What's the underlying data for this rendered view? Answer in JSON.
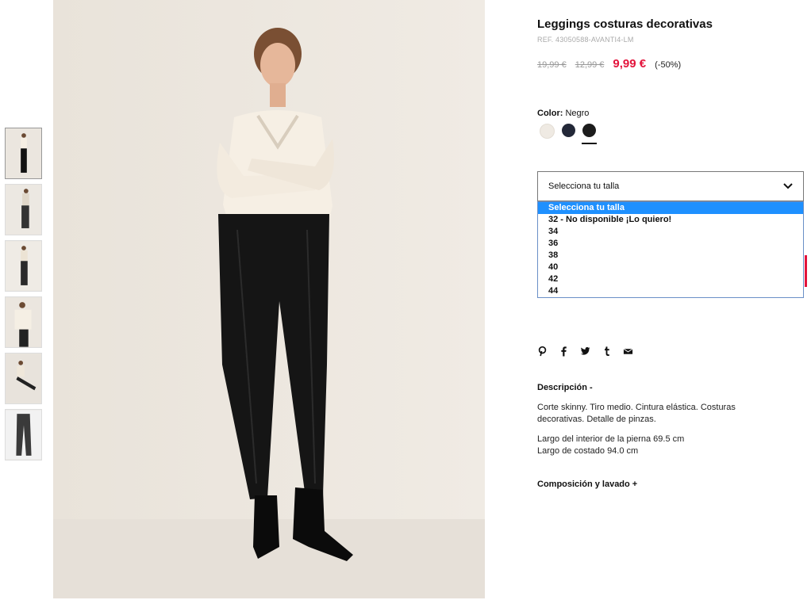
{
  "product": {
    "title": "Leggings costuras decorativas",
    "ref": "REF. 43050588-AVANTI4-LM",
    "price_original_1": "19,99 €",
    "price_original_2": "12,99 €",
    "price_current": "9,99 €",
    "discount": "(-50%)"
  },
  "color": {
    "label": "Color:",
    "value": "Negro",
    "swatches": [
      {
        "name": "off-white",
        "hex": "#efeae3"
      },
      {
        "name": "navy",
        "hex": "#232838"
      },
      {
        "name": "black",
        "hex": "#1c1c1c"
      }
    ],
    "selected_index": 2
  },
  "size": {
    "selected": "Selecciona tu talla",
    "options": [
      "Selecciona tu talla",
      "32 - No disponible ¡Lo quiero!",
      "34",
      "36",
      "38",
      "40",
      "42",
      "44"
    ]
  },
  "share": [
    "pinterest-icon",
    "facebook-icon",
    "twitter-icon",
    "tumblr-icon",
    "email-icon"
  ],
  "description": {
    "heading": "Descripción  -",
    "p1": "Corte skinny. Tiro medio. Cintura elástica. Costuras decorativas. Detalle de pinzas.",
    "p2_line1": "Largo del interior de la pierna 69.5 cm",
    "p2_line2": "Largo de costado 94.0 cm"
  },
  "composition": {
    "label": "Composición y lavado  +"
  },
  "colors": {
    "accent": "#e3133b",
    "dropdown_highlight": "#1e90ff"
  }
}
